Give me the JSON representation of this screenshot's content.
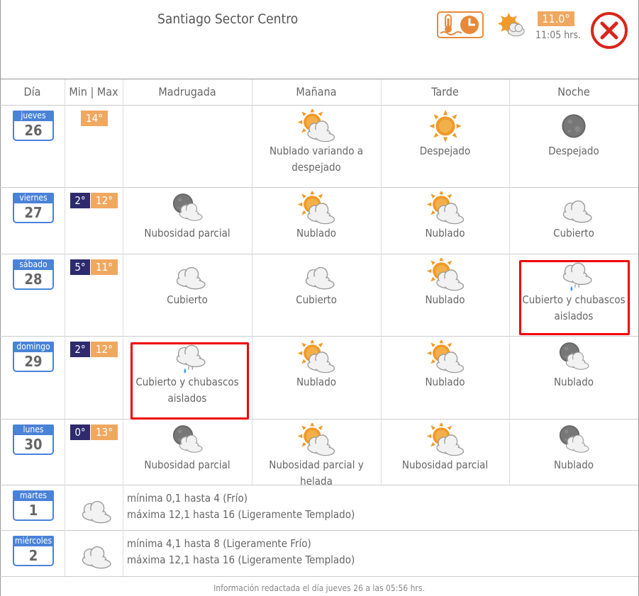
{
  "header": {
    "title": "Santiago Sector Centro",
    "current_temp": "11.0°",
    "current_time": "11:05 hrs.",
    "history_icon": "thermometer-clock-icon",
    "current_icon": "partly-cloudy-icon",
    "close_icon": "close-icon"
  },
  "columns": [
    "Día",
    "Min | Max",
    "Madrugada",
    "Mañana",
    "Tarde",
    "Noche"
  ],
  "days": [
    {
      "name": "jueves",
      "num": "26",
      "min": "",
      "max": "14°",
      "periods": [
        null,
        {
          "icon": "sun-cloud",
          "label": "Nublado variando a despejado"
        },
        {
          "icon": "sun",
          "label": "Despejado"
        },
        {
          "icon": "moon",
          "label": "Despejado"
        }
      ]
    },
    {
      "name": "viernes",
      "num": "27",
      "min": "2°",
      "max": "12°",
      "periods": [
        {
          "icon": "moon-cloud",
          "label": "Nubosidad parcial"
        },
        {
          "icon": "sun-cloud",
          "label": "Nublado"
        },
        {
          "icon": "sun-cloud",
          "label": "Nublado"
        },
        {
          "icon": "cloud",
          "label": "Cubierto"
        }
      ]
    },
    {
      "name": "sábado",
      "num": "28",
      "min": "5°",
      "max": "11°",
      "periods": [
        {
          "icon": "cloud",
          "label": "Cubierto"
        },
        {
          "icon": "cloud",
          "label": "Cubierto"
        },
        {
          "icon": "sun-cloud",
          "label": "Nublado"
        },
        {
          "icon": "cloud-rain",
          "label": "Cubierto y chubascos aislados"
        }
      ]
    },
    {
      "name": "domingo",
      "num": "29",
      "min": "2°",
      "max": "12°",
      "periods": [
        {
          "icon": "cloud-rain",
          "label": "Cubierto y chubascos aislados"
        },
        {
          "icon": "sun-cloud",
          "label": "Nublado"
        },
        {
          "icon": "sun-cloud",
          "label": "Nublado"
        },
        {
          "icon": "moon-cloud",
          "label": "Nublado"
        }
      ]
    },
    {
      "name": "lunes",
      "num": "30",
      "min": "0°",
      "max": "13°",
      "periods": [
        {
          "icon": "moon-cloud",
          "label": "Nubosidad parcial"
        },
        {
          "icon": "sun-cloud",
          "label": "Nubosidad parcial y helada"
        },
        {
          "icon": "sun-cloud",
          "label": "Nubosidad parcial"
        },
        {
          "icon": "moon-cloud",
          "label": "Nublado"
        }
      ]
    }
  ],
  "extended": [
    {
      "name": "martes",
      "num": "1",
      "icon": "cloud",
      "min_text": "mínima 0,1 hasta 4 (Frío)",
      "max_text": "máxima 12,1 hasta 16 (Ligeramente Templado)"
    },
    {
      "name": "miércoles",
      "num": "2",
      "icon": "cloud",
      "min_text": "mínima 4,1 hasta 8 (Ligeramente Frío)",
      "max_text": "máxima 12,1 hasta 16 (Ligeramente Templado)"
    }
  ],
  "footer": "Información redactada el día jueves 26 a las 05:56 hrs.",
  "colors": {
    "calendar": "#4a82d8",
    "min": "#2d2a6e",
    "max": "#f0a861",
    "highlight": "#e00000"
  }
}
